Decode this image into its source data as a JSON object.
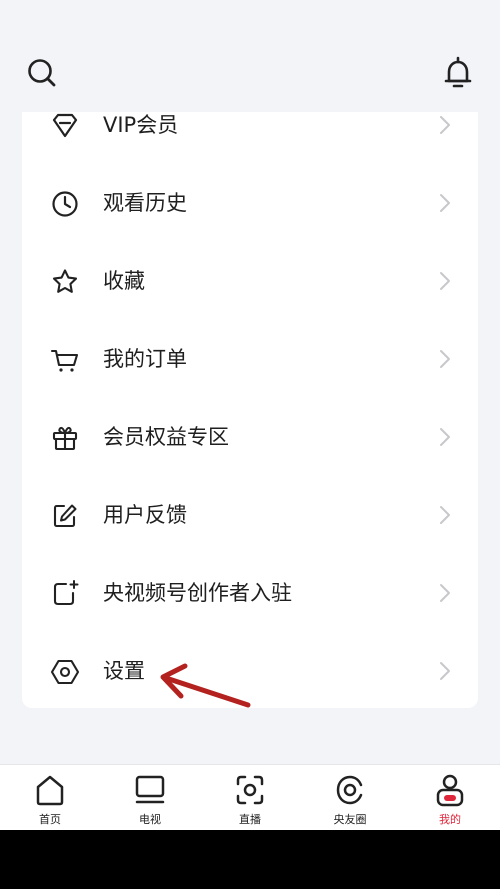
{
  "header": {
    "left_icon": "search-icon",
    "right_icon": "bell-icon"
  },
  "menu": {
    "items": [
      {
        "label": "VIP会员",
        "icon": "diamond-icon"
      },
      {
        "label": "观看历史",
        "icon": "clock-icon"
      },
      {
        "label": "收藏",
        "icon": "star-icon"
      },
      {
        "label": "我的订单",
        "icon": "cart-icon"
      },
      {
        "label": "会员权益专区",
        "icon": "gift-icon"
      },
      {
        "label": "用户反馈",
        "icon": "edit-icon"
      },
      {
        "label": "央视频号创作者入驻",
        "icon": "creator-icon"
      },
      {
        "label": "设置",
        "icon": "hexagon-settings-icon"
      }
    ]
  },
  "annotation": {
    "icon": "red-arrow",
    "color": "#b3221f"
  },
  "tabbar": {
    "tabs": [
      {
        "label": "首页",
        "icon": "home-icon",
        "active": false
      },
      {
        "label": "电视",
        "icon": "tv-icon",
        "active": false
      },
      {
        "label": "直播",
        "icon": "live-icon",
        "active": false
      },
      {
        "label": "央友圈",
        "icon": "community-icon",
        "active": false
      },
      {
        "label": "我的",
        "icon": "profile-icon",
        "active": true
      }
    ],
    "active_color": "#e0263b"
  }
}
